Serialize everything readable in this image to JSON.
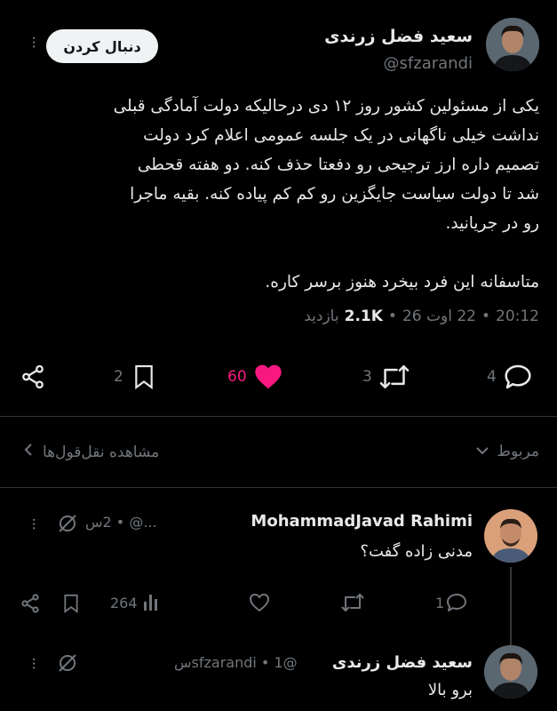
{
  "main_tweet": {
    "display_name": "سعید فضل زرندی",
    "handle": "@sfzarandi",
    "follow_label": "دنبال کردن",
    "body_lines": [
      "یکی از مسئولین کشور روز ۱۲ دی درحالیکه دولت آمادگی قبلی",
      "نداشت خیلی ناگهانی در یک جلسه عمومی اعلام کرد دولت",
      "تصمیم داره ارز ترجیحی رو دفعتا حذف کنه. دو هفته قحطی",
      "شد تا دولت سیاست جایگزین رو کم کم پیاده کنه. بقیه ماجرا",
      "رو در جریانید."
    ],
    "body_line2": "متاسفانه این فرد بیخرد هنوز برسر کاره.",
    "time": "20:12",
    "date": "22 اوت 26",
    "views_count": "2.1K",
    "views_label": "بازدید",
    "replies": "4",
    "retweets": "3",
    "likes": "60",
    "bookmarks": "2",
    "colors": {
      "like": "#f91880",
      "background": "#000000",
      "muted": "#71767b"
    }
  },
  "related_bar": {
    "label": "مربوط",
    "quotes_link": "مشاهده نقل‌قول‌ها"
  },
  "replies": [
    {
      "display_name": "MohammadJavad Rahimi",
      "meta": "...@ • 2س",
      "text": "مدنی زاده گفت؟",
      "reply_count": "1",
      "view_count": "264"
    },
    {
      "display_name": "سعید فضل زرندی",
      "meta": "@sfzarandi • 1س",
      "text": "برو بالا"
    }
  ],
  "icons": [
    "share-icon",
    "bookmark-icon",
    "heart-icon",
    "retweet-icon",
    "reply-icon",
    "chevron-down-icon",
    "chevron-left-icon",
    "grok-icon",
    "views-icon",
    "more-icon"
  ]
}
